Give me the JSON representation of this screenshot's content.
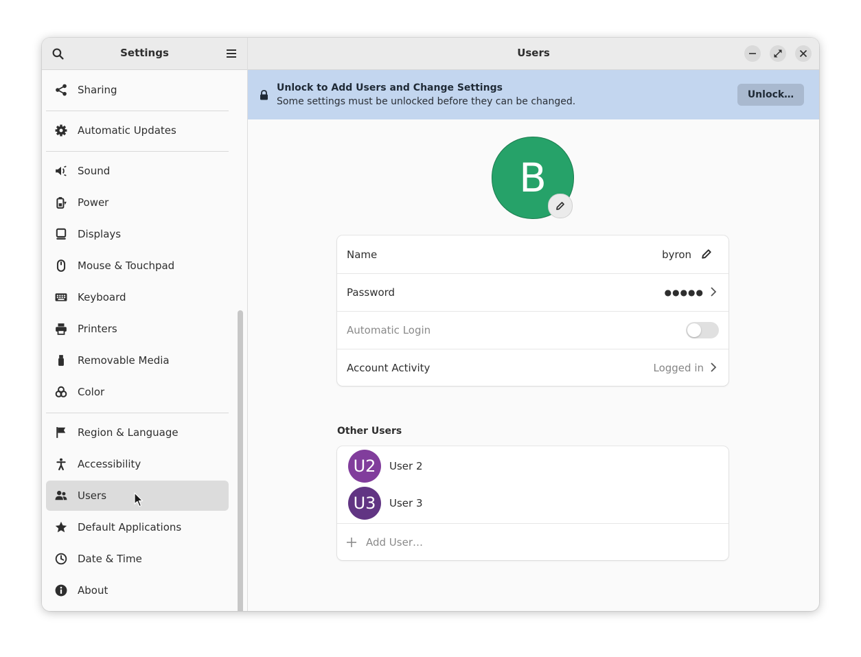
{
  "sidebar": {
    "title": "Settings",
    "items": [
      {
        "label": "Sharing",
        "icon": "share-icon",
        "name": "sidebar-item-sharing"
      },
      {
        "label": "Automatic Updates",
        "icon": "gear-icon",
        "name": "sidebar-item-automatic-updates"
      },
      {
        "label": "Sound",
        "icon": "speaker-icon",
        "name": "sidebar-item-sound"
      },
      {
        "label": "Power",
        "icon": "battery-icon",
        "name": "sidebar-item-power"
      },
      {
        "label": "Displays",
        "icon": "monitor-icon",
        "name": "sidebar-item-displays"
      },
      {
        "label": "Mouse & Touchpad",
        "icon": "mouse-icon",
        "name": "sidebar-item-mouse-touchpad"
      },
      {
        "label": "Keyboard",
        "icon": "keyboard-icon",
        "name": "sidebar-item-keyboard"
      },
      {
        "label": "Printers",
        "icon": "printer-icon",
        "name": "sidebar-item-printers"
      },
      {
        "label": "Removable Media",
        "icon": "usb-icon",
        "name": "sidebar-item-removable-media"
      },
      {
        "label": "Color",
        "icon": "color-icon",
        "name": "sidebar-item-color"
      },
      {
        "label": "Region & Language",
        "icon": "flag-icon",
        "name": "sidebar-item-region-language"
      },
      {
        "label": "Accessibility",
        "icon": "accessibility-icon",
        "name": "sidebar-item-accessibility"
      },
      {
        "label": "Users",
        "icon": "users-icon",
        "name": "sidebar-item-users",
        "selected": true
      },
      {
        "label": "Default Applications",
        "icon": "star-icon",
        "name": "sidebar-item-default-applications"
      },
      {
        "label": "Date & Time",
        "icon": "clock-icon",
        "name": "sidebar-item-date-time"
      },
      {
        "label": "About",
        "icon": "info-icon",
        "name": "sidebar-item-about"
      }
    ]
  },
  "header": {
    "title": "Users"
  },
  "infobar": {
    "title": "Unlock to Add Users and Change Settings",
    "subtitle": "Some settings must be unlocked before they can be changed.",
    "unlock_label": "Unlock…"
  },
  "account": {
    "avatar_letter": "B",
    "avatar_color": "#26a269",
    "rows": {
      "name_label": "Name",
      "name_value": "byron",
      "password_label": "Password",
      "password_value": "●●●●●",
      "autologin_label": "Automatic Login",
      "autologin_on": false,
      "activity_label": "Account Activity",
      "activity_value": "Logged in"
    }
  },
  "other_users": {
    "title": "Other Users",
    "users": [
      {
        "initials": "U2",
        "name": "User 2",
        "color": "#813d9c"
      },
      {
        "initials": "U3",
        "name": "User 3",
        "color": "#613583"
      }
    ],
    "add_label": "Add User…"
  }
}
